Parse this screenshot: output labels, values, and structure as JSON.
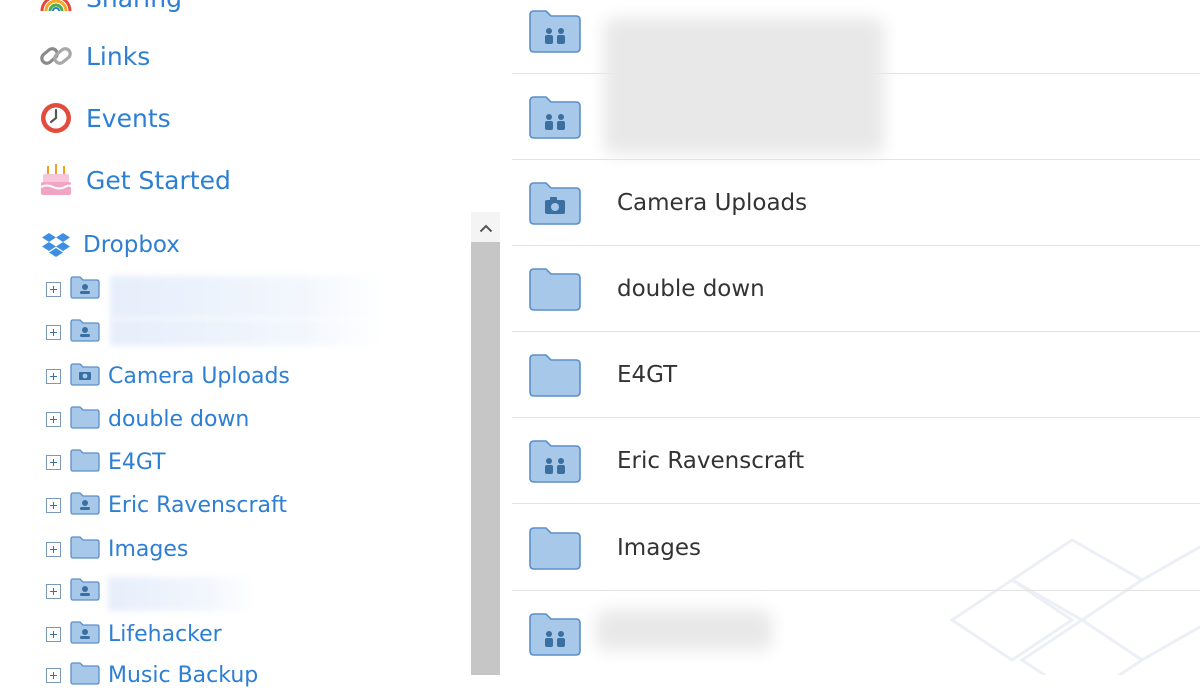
{
  "sidebar": {
    "nav": [
      {
        "label": "Sharing",
        "icon": "rainbow-icon"
      },
      {
        "label": "Links",
        "icon": "chain-link-icon"
      },
      {
        "label": "Events",
        "icon": "clock-icon"
      },
      {
        "label": "Get Started",
        "icon": "birthday-cake-icon"
      }
    ],
    "root": {
      "label": "Dropbox",
      "icon": "dropbox-logo-icon"
    },
    "tree": [
      {
        "label": "",
        "icon": "shared-folder-icon"
      },
      {
        "label": "",
        "icon": "shared-folder-icon"
      },
      {
        "label": "Camera Uploads",
        "icon": "camera-folder-icon"
      },
      {
        "label": "double down",
        "icon": "folder-icon"
      },
      {
        "label": "E4GT",
        "icon": "folder-icon"
      },
      {
        "label": "Eric Ravenscraft",
        "icon": "shared-folder-icon"
      },
      {
        "label": "Images",
        "icon": "folder-icon"
      },
      {
        "label": "",
        "icon": "shared-folder-icon"
      },
      {
        "label": "Lifehacker",
        "icon": "shared-folder-icon"
      },
      {
        "label": "Music Backup",
        "icon": "folder-icon"
      }
    ]
  },
  "files": [
    {
      "name": "",
      "icon": "shared-folder-icon"
    },
    {
      "name": "",
      "icon": "shared-folder-icon"
    },
    {
      "name": "Camera Uploads",
      "icon": "camera-folder-icon"
    },
    {
      "name": "double down",
      "icon": "folder-icon"
    },
    {
      "name": "E4GT",
      "icon": "folder-icon"
    },
    {
      "name": "Eric Ravenscraft",
      "icon": "shared-folder-icon"
    },
    {
      "name": "Images",
      "icon": "folder-icon"
    },
    {
      "name": "",
      "icon": "shared-folder-icon"
    }
  ],
  "colors": {
    "link": "#2d7fd3",
    "folder": "#a8c8ea",
    "folder_stroke": "#5b8fc9",
    "text": "#333333"
  }
}
